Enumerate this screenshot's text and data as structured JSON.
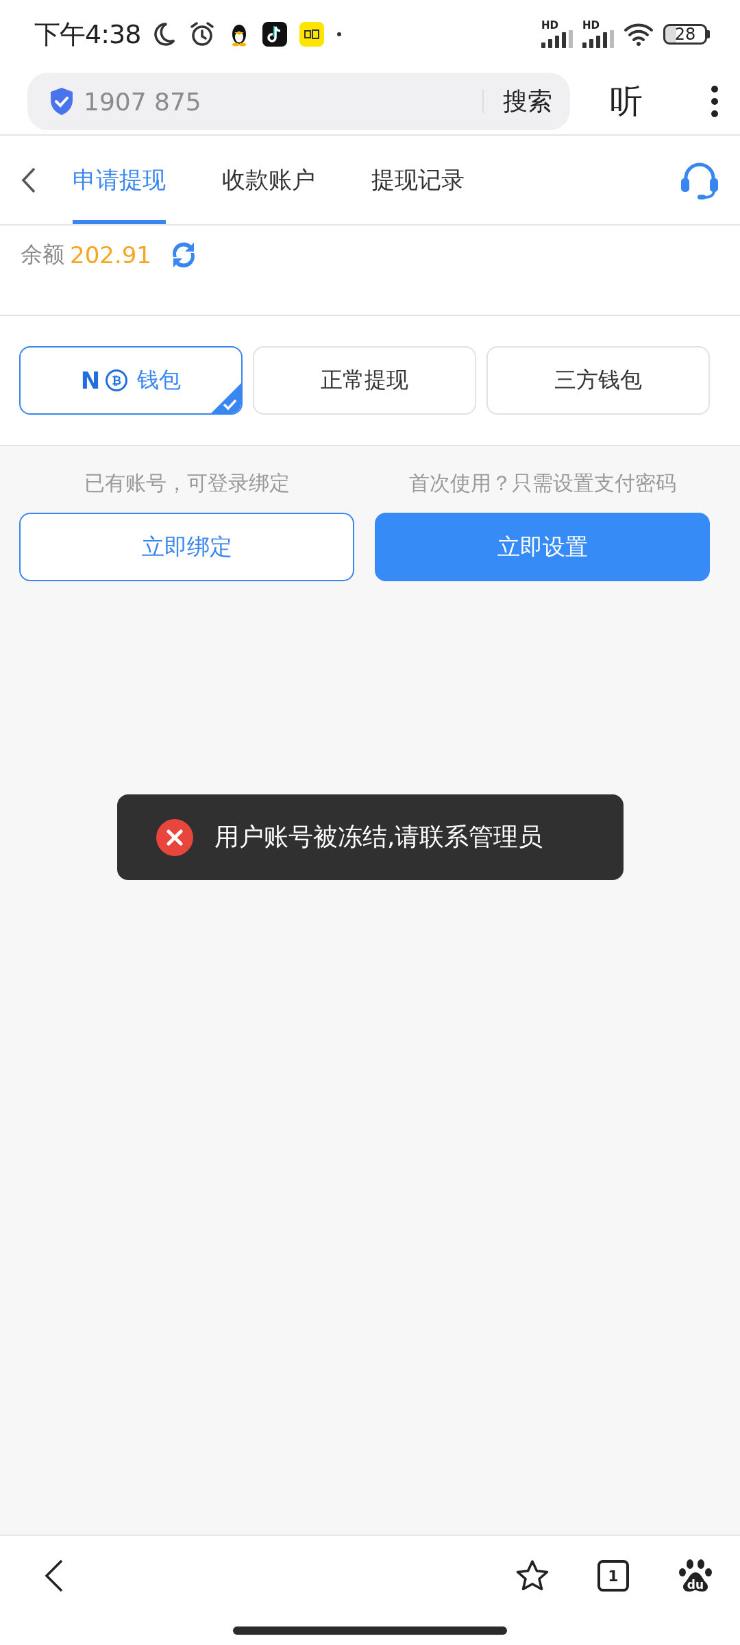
{
  "status_bar": {
    "time": "下午4:38",
    "signals": [
      {
        "label": "HD"
      },
      {
        "label": "HD"
      }
    ],
    "battery": "28"
  },
  "address_bar": {
    "url": "1907 875",
    "search_button": "搜索",
    "listen_button": "听"
  },
  "tabs": [
    {
      "label": "申请提现",
      "selected": true
    },
    {
      "label": "收款账户",
      "selected": false
    },
    {
      "label": "提现记录",
      "selected": false
    }
  ],
  "balance": {
    "label": "余额",
    "amount": "202.91"
  },
  "wallet_options": [
    {
      "kind": "coin",
      "logo": "N",
      "coin": "₿",
      "label": "钱包",
      "selected": true
    },
    {
      "kind": "plain",
      "label": "正常提现",
      "selected": false
    },
    {
      "kind": "plain",
      "label": "三方钱包",
      "selected": false
    }
  ],
  "actions": [
    {
      "kind": "outline",
      "hint": "已有账号，可登录绑定",
      "button": "立即绑定"
    },
    {
      "kind": "primary",
      "hint": "首次使用？只需设置支付密码",
      "button": "立即设置"
    }
  ],
  "toast": {
    "kind": "error",
    "message": "用户账号被冻结,请联系管理员"
  },
  "bottom_bar": {
    "tab_count": "1",
    "logo_text": "du"
  }
}
